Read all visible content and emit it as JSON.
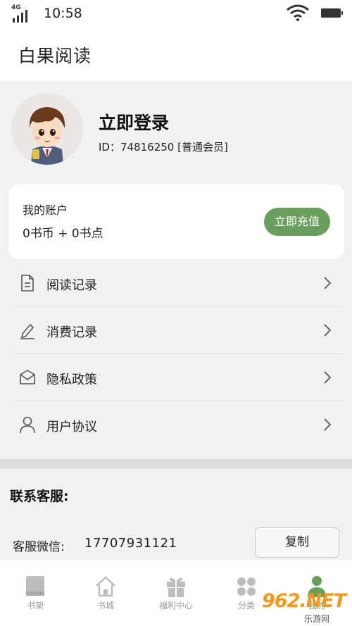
{
  "status_bar": {
    "network": "4G",
    "time": "10:58"
  },
  "app": {
    "title": "白果阅读"
  },
  "profile": {
    "login_label": "立即登录",
    "member_id": "ID：74816250 [普通会员]"
  },
  "account": {
    "label": "我的账户",
    "balance": "0书币 + 0书点",
    "recharge_label": "立即充值",
    "accent_color": "#6a9e5d"
  },
  "menu": {
    "items": [
      {
        "label": "阅读记录",
        "icon": "document-icon"
      },
      {
        "label": "消费记录",
        "icon": "pen-icon"
      },
      {
        "label": "隐私政策",
        "icon": "envelope-icon"
      },
      {
        "label": "用户协议",
        "icon": "user-icon"
      }
    ]
  },
  "contact": {
    "title": "联系客服:",
    "wechat_label": "客服微信:",
    "wechat_value": "17707931121",
    "copy_label": "复制"
  },
  "tabs": [
    {
      "label": "书架",
      "icon": "bookshelf-icon",
      "active": false
    },
    {
      "label": "书城",
      "icon": "home-icon",
      "active": false
    },
    {
      "label": "福利中心",
      "icon": "gift-icon",
      "active": false
    },
    {
      "label": "分类",
      "icon": "category-icon",
      "active": false
    },
    {
      "label": "我的",
      "icon": "profile-icon",
      "active": true
    }
  ],
  "watermark": {
    "brand": "962.NET",
    "sub": "乐游网"
  }
}
